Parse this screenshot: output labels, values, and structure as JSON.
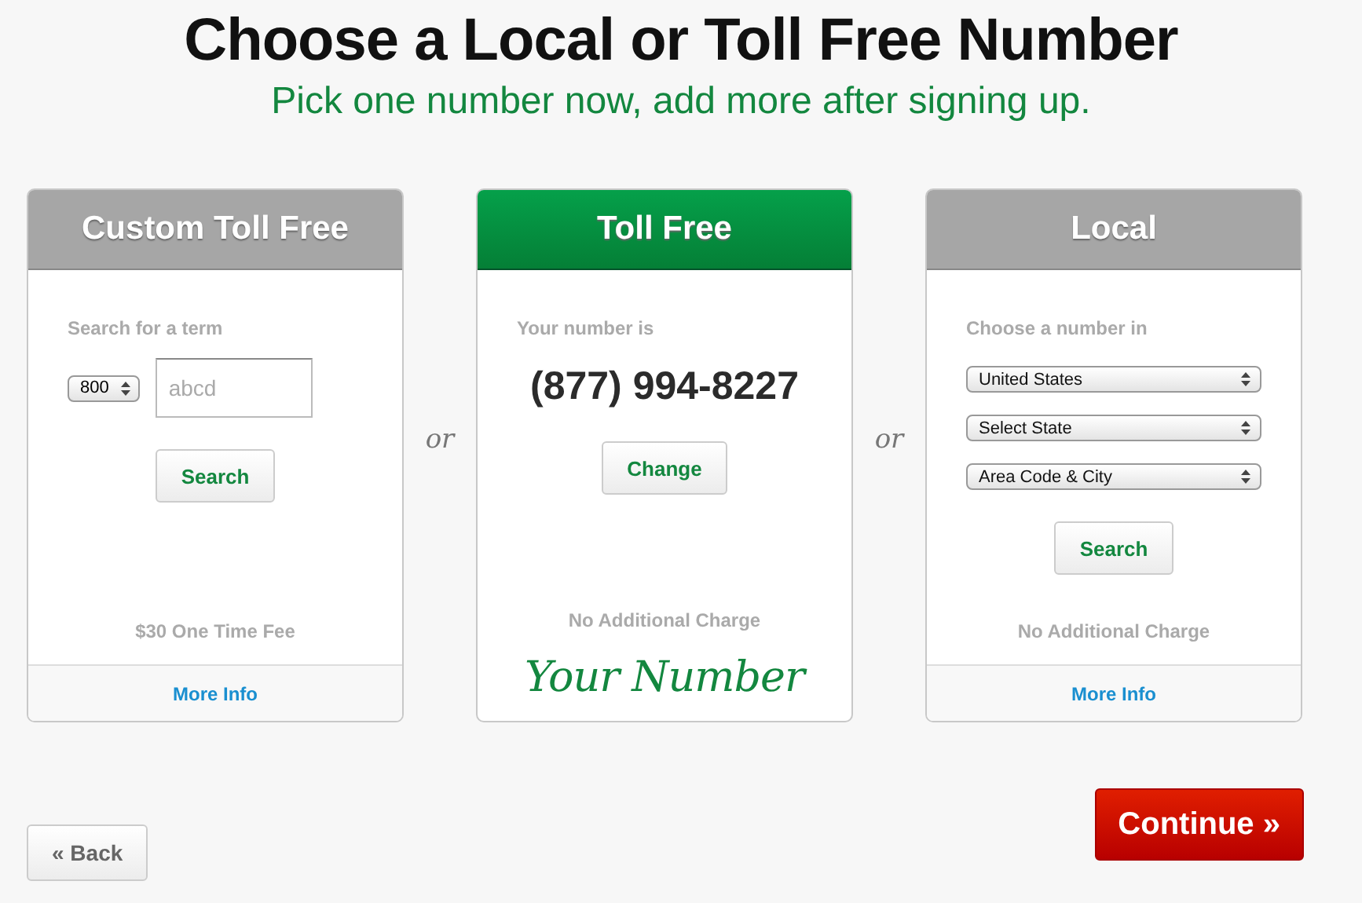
{
  "heading": {
    "title": "Choose a Local or Toll Free Number",
    "subtitle": "Pick one number now, add more after signing up."
  },
  "cards": [
    {
      "title": "Custom Toll Free",
      "selected": false,
      "items": [
        {
          "kind": "label",
          "text": "Search for a term"
        },
        {
          "kind": "term_row",
          "prefix": "800",
          "placeholder": "abcd"
        },
        {
          "kind": "button",
          "text": "Search"
        },
        {
          "kind": "note",
          "text": "$30 One Time Fee"
        }
      ],
      "footer": "More Info"
    },
    {
      "title": "Toll Free",
      "selected": true,
      "items": [
        {
          "kind": "label",
          "text": "Your number is"
        },
        {
          "kind": "number",
          "text": "(877) 994-8227"
        },
        {
          "kind": "button",
          "text": "Change"
        },
        {
          "kind": "note",
          "text": "No Additional Charge"
        },
        {
          "kind": "signature",
          "text": "Your Number"
        }
      ]
    },
    {
      "title": "Local",
      "selected": false,
      "items": [
        {
          "kind": "label",
          "text": "Choose a number in"
        },
        {
          "kind": "select",
          "text": "United States"
        },
        {
          "kind": "select",
          "text": "Select State"
        },
        {
          "kind": "select",
          "text": "Area Code & City"
        },
        {
          "kind": "button",
          "text": "Search"
        },
        {
          "kind": "note",
          "text": "No Additional Charge"
        }
      ],
      "footer": "More Info"
    }
  ],
  "separators": [
    "or",
    "or"
  ],
  "back_button": "« Back",
  "continue_button": "Continue »"
}
